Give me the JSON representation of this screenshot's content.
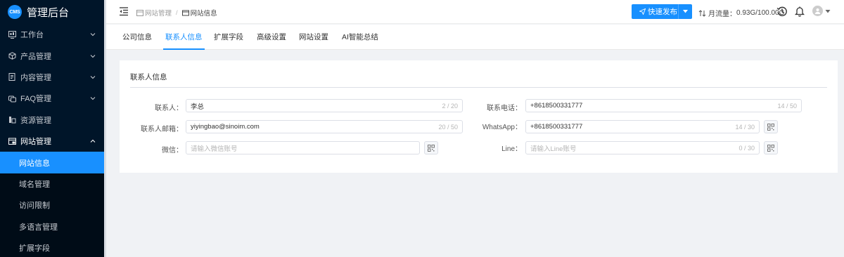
{
  "app": {
    "logo_text": "CMS",
    "title": "管理后台"
  },
  "sidebar": {
    "items": [
      {
        "label": "工作台",
        "icon": "dashboard-icon"
      },
      {
        "label": "产品管理",
        "icon": "cube-icon"
      },
      {
        "label": "内容管理",
        "icon": "document-icon"
      },
      {
        "label": "FAQ管理",
        "icon": "faq-icon"
      },
      {
        "label": "资源管理",
        "icon": "folder-icon"
      },
      {
        "label": "网站管理",
        "icon": "website-icon"
      }
    ],
    "sub_items": [
      {
        "label": "网站信息",
        "active": true
      },
      {
        "label": "域名管理"
      },
      {
        "label": "访问限制"
      },
      {
        "label": "多语言管理"
      },
      {
        "label": "扩展字段"
      }
    ]
  },
  "header": {
    "breadcrumb": [
      "网站管理",
      "网站信息"
    ],
    "quick_publish": "快速发布",
    "traffic_label": "月流量：",
    "traffic_value": "0.93G/100.00G",
    "icons": [
      "fold-menu-icon",
      "history-clock-icon",
      "bell-icon",
      "user-avatar-icon"
    ]
  },
  "tabs": [
    "公司信息",
    "联系人信息",
    "扩展字段",
    "高级设置",
    "网站设置",
    "AI智能总结"
  ],
  "active_tab": "联系人信息",
  "form": {
    "section_title": "联系人信息",
    "contact": {
      "label": "联系人：",
      "value": "李总",
      "count": "2 / 20"
    },
    "email": {
      "label": "联系人邮箱：",
      "value": "yiyingbao@sinoim.com",
      "count": "20 / 50"
    },
    "wechat": {
      "label": "微信：",
      "placeholder": "请输入微信账号"
    },
    "phone": {
      "label": "联系电话：",
      "value": "+8618500331777",
      "count": "14 / 50"
    },
    "whatsapp": {
      "label": "WhatsApp：",
      "value": "+8618500331777",
      "count": "14 / 30"
    },
    "line": {
      "label": "Line：",
      "placeholder": "请输入Line账号",
      "count": "0 / 30"
    }
  },
  "colors": {
    "sidebar_bg": "#001529",
    "accent": "#1890ff",
    "page_bg": "#f0f2f5"
  }
}
